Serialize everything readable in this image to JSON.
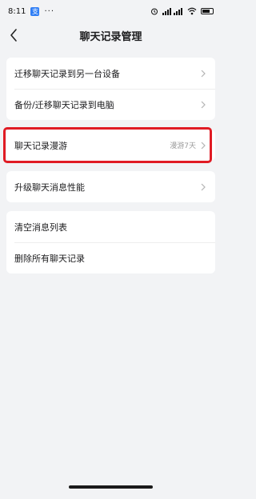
{
  "status_bar": {
    "time": "8:11",
    "app_badge": "支",
    "more": "···",
    "signal_text": "4G"
  },
  "header": {
    "title": "聊天记录管理"
  },
  "groups": [
    {
      "items": [
        {
          "label": "迁移聊天记录到另一台设备"
        },
        {
          "label": "备份/迁移聊天记录到电脑"
        }
      ]
    },
    {
      "items": [
        {
          "label": "聊天记录漫游",
          "value": "漫游7天"
        }
      ]
    },
    {
      "items": [
        {
          "label": "升级聊天消息性能"
        }
      ]
    },
    {
      "items": [
        {
          "label": "清空消息列表"
        },
        {
          "label": "删除所有聊天记录"
        }
      ]
    }
  ],
  "colors": {
    "background": "#f2f3f5",
    "highlight": "#e01b24",
    "badge": "#2f7ef5"
  }
}
